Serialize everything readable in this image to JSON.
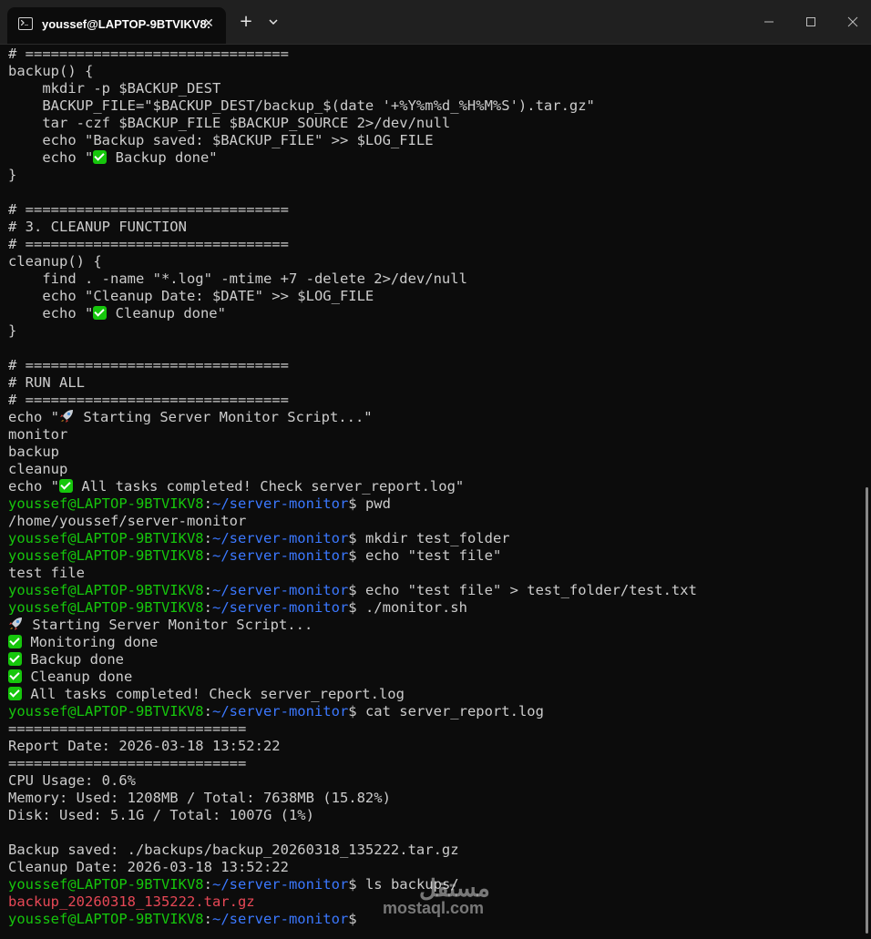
{
  "window": {
    "tab_title": "youssef@LAPTOP-9BTVIKV8: ",
    "tab_close": "✕",
    "new_tab": "+"
  },
  "prompt": {
    "user": "youssef@LAPTOP-9BTVIKV8",
    "sep": ":",
    "path": "~/server-monitor",
    "dollar": "$ "
  },
  "script_lines": [
    "# ===============================",
    "backup() {",
    "    mkdir -p $BACKUP_DEST",
    "    BACKUP_FILE=\"$BACKUP_DEST/backup_$(date '+%Y%m%d_%H%M%S').tar.gz\"",
    "    tar -czf $BACKUP_FILE $BACKUP_SOURCE 2>/dev/null",
    "    echo \"Backup saved: $BACKUP_FILE\" >> $LOG_FILE",
    {
      "pre": "    echo \"",
      "emoji": "check",
      "post": " Backup done\""
    },
    "}",
    "",
    "# ===============================",
    "# 3. CLEANUP FUNCTION",
    "# ===============================",
    "cleanup() {",
    "    find . -name \"*.log\" -mtime +7 -delete 2>/dev/null",
    "    echo \"Cleanup Date: $DATE\" >> $LOG_FILE",
    {
      "pre": "    echo \"",
      "emoji": "check",
      "post": " Cleanup done\""
    },
    "}",
    "",
    "# ===============================",
    "# RUN ALL",
    "# ===============================",
    {
      "pre": "echo \"",
      "emoji": "rocket",
      "post": " Starting Server Monitor Script...\""
    },
    "monitor",
    "backup",
    "cleanup",
    {
      "pre": "echo \"",
      "emoji": "check",
      "post": " All tasks completed! Check server_report.log\""
    }
  ],
  "session": [
    {
      "type": "cmd",
      "text": "pwd"
    },
    {
      "type": "out",
      "text": "/home/youssef/server-monitor"
    },
    {
      "type": "cmd",
      "text": "mkdir test_folder"
    },
    {
      "type": "cmd",
      "text": "echo \"test file\""
    },
    {
      "type": "out",
      "text": "test file"
    },
    {
      "type": "cmd",
      "text": "echo \"test file\" > test_folder/test.txt"
    },
    {
      "type": "cmd",
      "text": "./monitor.sh"
    },
    {
      "type": "emoji",
      "emoji": "rocket",
      "text": " Starting Server Monitor Script..."
    },
    {
      "type": "emoji",
      "emoji": "check",
      "text": " Monitoring done"
    },
    {
      "type": "emoji",
      "emoji": "check",
      "text": " Backup done"
    },
    {
      "type": "emoji",
      "emoji": "check",
      "text": " Cleanup done"
    },
    {
      "type": "emoji",
      "emoji": "check",
      "text": " All tasks completed! Check server_report.log"
    },
    {
      "type": "cmd",
      "text": "cat server_report.log"
    },
    {
      "type": "out",
      "text": "============================"
    },
    {
      "type": "out",
      "text": "Report Date: 2026-03-18 13:52:22"
    },
    {
      "type": "out",
      "text": "============================"
    },
    {
      "type": "out",
      "text": "CPU Usage: 0.6%"
    },
    {
      "type": "out",
      "text": "Memory: Used: 1208MB / Total: 7638MB (15.82%)"
    },
    {
      "type": "out",
      "text": "Disk: Used: 5.1G / Total: 1007G (1%)"
    },
    {
      "type": "out",
      "text": ""
    },
    {
      "type": "out",
      "text": "Backup saved: ./backups/backup_20260318_135222.tar.gz"
    },
    {
      "type": "out",
      "text": "Cleanup Date: 2026-03-18 13:52:22"
    },
    {
      "type": "cmd",
      "text": "ls backups/"
    },
    {
      "type": "red",
      "text": "backup_20260318_135222.tar.gz"
    },
    {
      "type": "cmd",
      "text": ""
    }
  ],
  "watermark": {
    "arabic": "مستقل",
    "latin": "mostaql.com"
  },
  "colors": {
    "background": "#0c0c0c",
    "text": "#cccccc",
    "prompt_user": "#16c60c",
    "prompt_path": "#3b78ff",
    "archive": "#e74856"
  }
}
